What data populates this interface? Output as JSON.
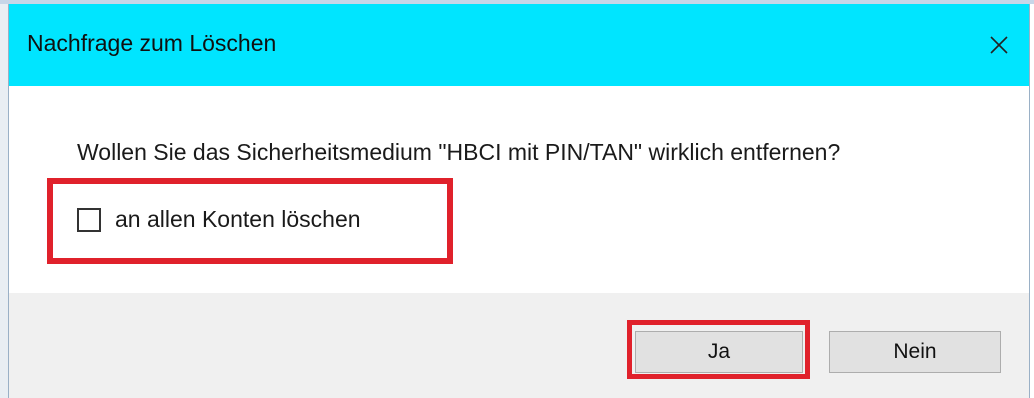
{
  "dialog": {
    "title": "Nachfrage zum Löschen",
    "close_icon": "close-icon",
    "message": "Wollen Sie das Sicherheitsmedium \"HBCI mit PIN/TAN\" wirklich entfernen?",
    "checkbox": {
      "label": "an allen Konten löschen",
      "checked": false
    },
    "buttons": {
      "yes_label": "Ja",
      "no_label": "Nein"
    }
  },
  "colors": {
    "titlebar": "#00e5ff",
    "highlight": "#e0212b",
    "footer": "#f0f0f0",
    "button": "#e1e1e1"
  }
}
